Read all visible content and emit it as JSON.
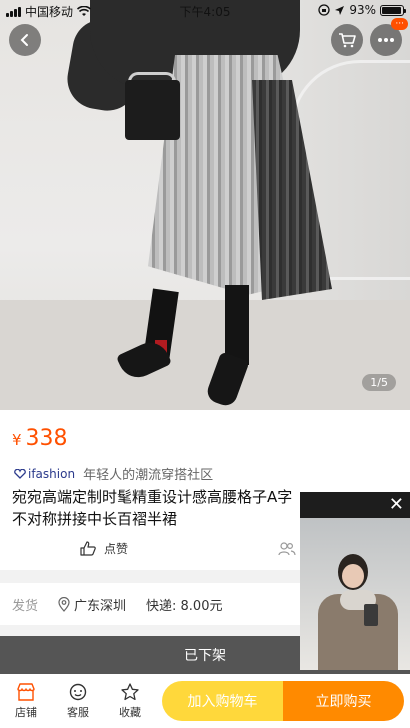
{
  "status_bar": {
    "carrier": "中国移动",
    "time": "下午4:05",
    "battery": "93%",
    "battery_level": 0.93
  },
  "hero": {
    "pager": "1/5"
  },
  "product": {
    "currency": "¥",
    "price": "338",
    "brand_logo": "ifashion",
    "brand_tagline": "年轻人的潮流穿搭社区",
    "title_line1": "宛宛高端定制时髦精重设计感高腰格子A字",
    "title_line2": "不对称拼接中长百褶半裙",
    "like_label": "点赞"
  },
  "shipping": {
    "label": "发货",
    "location": "广东深圳",
    "fee": "快递: 8.00元"
  },
  "delisted_banner": "已下架",
  "bottom_bar": {
    "store": "店铺",
    "service": "客服",
    "favorite": "收藏",
    "add_to_cart": "加入购物车",
    "buy_now": "立即购买"
  },
  "more_badge": "···"
}
